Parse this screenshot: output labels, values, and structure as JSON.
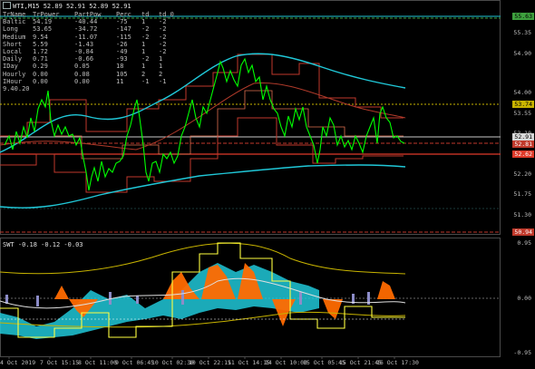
{
  "header": {
    "symbol_line": "WTI,M15  52.89 52.91 52.89 52.91"
  },
  "table": {
    "columns": [
      "TrName",
      "TrPower",
      "PartPow",
      "Perc",
      "td",
      "td_0"
    ],
    "rows": [
      [
        "Baltic",
        "54.19",
        "-40.44",
        "-75",
        "1",
        "-2"
      ],
      [
        "Long",
        "53.65",
        "-34.72",
        "-147",
        "-2",
        "-2"
      ],
      [
        "Medium",
        "9.54",
        "-11.07",
        "-115",
        "-2",
        "-2"
      ],
      [
        "Short",
        "5.59",
        "-1.43",
        "-26",
        "1",
        "-2"
      ],
      [
        "Local",
        "1.72",
        "-0.84",
        "-49",
        "1",
        "-2"
      ],
      [
        "Daily",
        "0.71",
        "-0.66",
        "-93",
        "-2",
        "1"
      ],
      [
        "IDay",
        "0.29",
        "0.05",
        "18",
        "1",
        "1"
      ],
      [
        "Hourly",
        "0.00",
        "0.08",
        "105",
        "2",
        "2"
      ],
      [
        "IHour",
        "0.00",
        "0.00",
        "11",
        "-1",
        "-1"
      ]
    ],
    "footer": "9.40.20"
  },
  "price_axis": {
    "labels": [
      "55.35",
      "54.90",
      "54.00",
      "53.55",
      "53.10",
      "52.20",
      "51.75",
      "51.30"
    ],
    "badges": [
      {
        "text": "55.63",
        "color": "#3ea03e"
      },
      {
        "text": "53.74",
        "color": "#c8b400"
      },
      {
        "text": "52.91",
        "color": "#d8d8d8"
      },
      {
        "text": "52.81",
        "color": "#c0392b"
      },
      {
        "text": "52.62",
        "color": "#e03a2a"
      },
      {
        "text": "50.94",
        "color": "#c0392b"
      }
    ]
  },
  "indicator": {
    "title": "SWT -0.18 -0.12 -0.03",
    "levels": [
      "0.95",
      "0.00",
      "-0.95"
    ]
  },
  "time_axis": [
    "4 Oct 2019",
    "7 Oct 15:15",
    "8 Oct 11:00",
    "9 Oct 06:45",
    "10 Oct 02:30",
    "10 Oct 22:15",
    "11 Oct 14:15",
    "14 Oct 10:00",
    "15 Oct 05:45",
    "15 Oct 21:45",
    "16 Oct 17:30"
  ],
  "colors": {
    "price": "#00ff00",
    "ma": "#20c8d8",
    "trend": "#c0392b",
    "guide": "#c8b400",
    "osc_fill": "#20c8d8",
    "osc_hist": "#ff6a00",
    "osc_bar": "#8c8cc8"
  }
}
